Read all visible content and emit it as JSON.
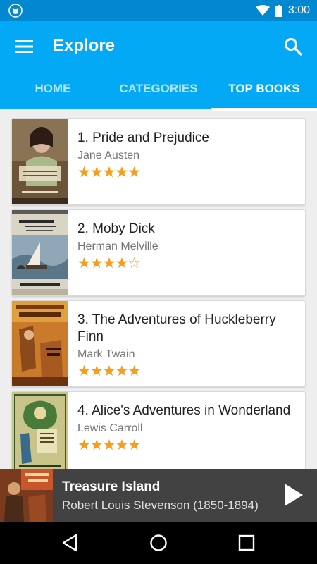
{
  "status_bar": {
    "time": "3:00",
    "icons": [
      "cat-app-icon",
      "wifi-icon",
      "battery-icon"
    ]
  },
  "app_bar": {
    "title": "Explore",
    "menu_icon": "hamburger-menu-icon",
    "search_icon": "search-icon"
  },
  "tabs": [
    {
      "label": "HOME",
      "active": false
    },
    {
      "label": "CATEGORIES",
      "active": false
    },
    {
      "label": "TOP BOOKS",
      "active": true
    }
  ],
  "books": [
    {
      "title": "1. Pride and Prejudice",
      "author": "Jane Austen",
      "stars": "★★★★★",
      "rating": 5
    },
    {
      "title": "2. Moby Dick",
      "author": "Herman Melville",
      "stars": "★★★★☆",
      "rating": 4
    },
    {
      "title": "3. The Adventures of Huckleberry Finn",
      "author": "Mark Twain",
      "stars": "★★★★★",
      "rating": 5
    },
    {
      "title": "4. Alice's Adventures in Wonderland",
      "author": "Lewis Carroll",
      "stars": "★★★★★",
      "rating": 5
    }
  ],
  "player": {
    "title": "Treasure Island",
    "subtitle": "Robert Louis Stevenson (1850-1894)",
    "icon": "play-icon"
  },
  "nav": {
    "icons": [
      "back-icon",
      "home-icon",
      "recents-icon"
    ]
  },
  "colors": {
    "primary": "#03a9f4",
    "primary_dark": "#0288d1",
    "star": "#f59d1c",
    "player_bg": "#424242"
  }
}
